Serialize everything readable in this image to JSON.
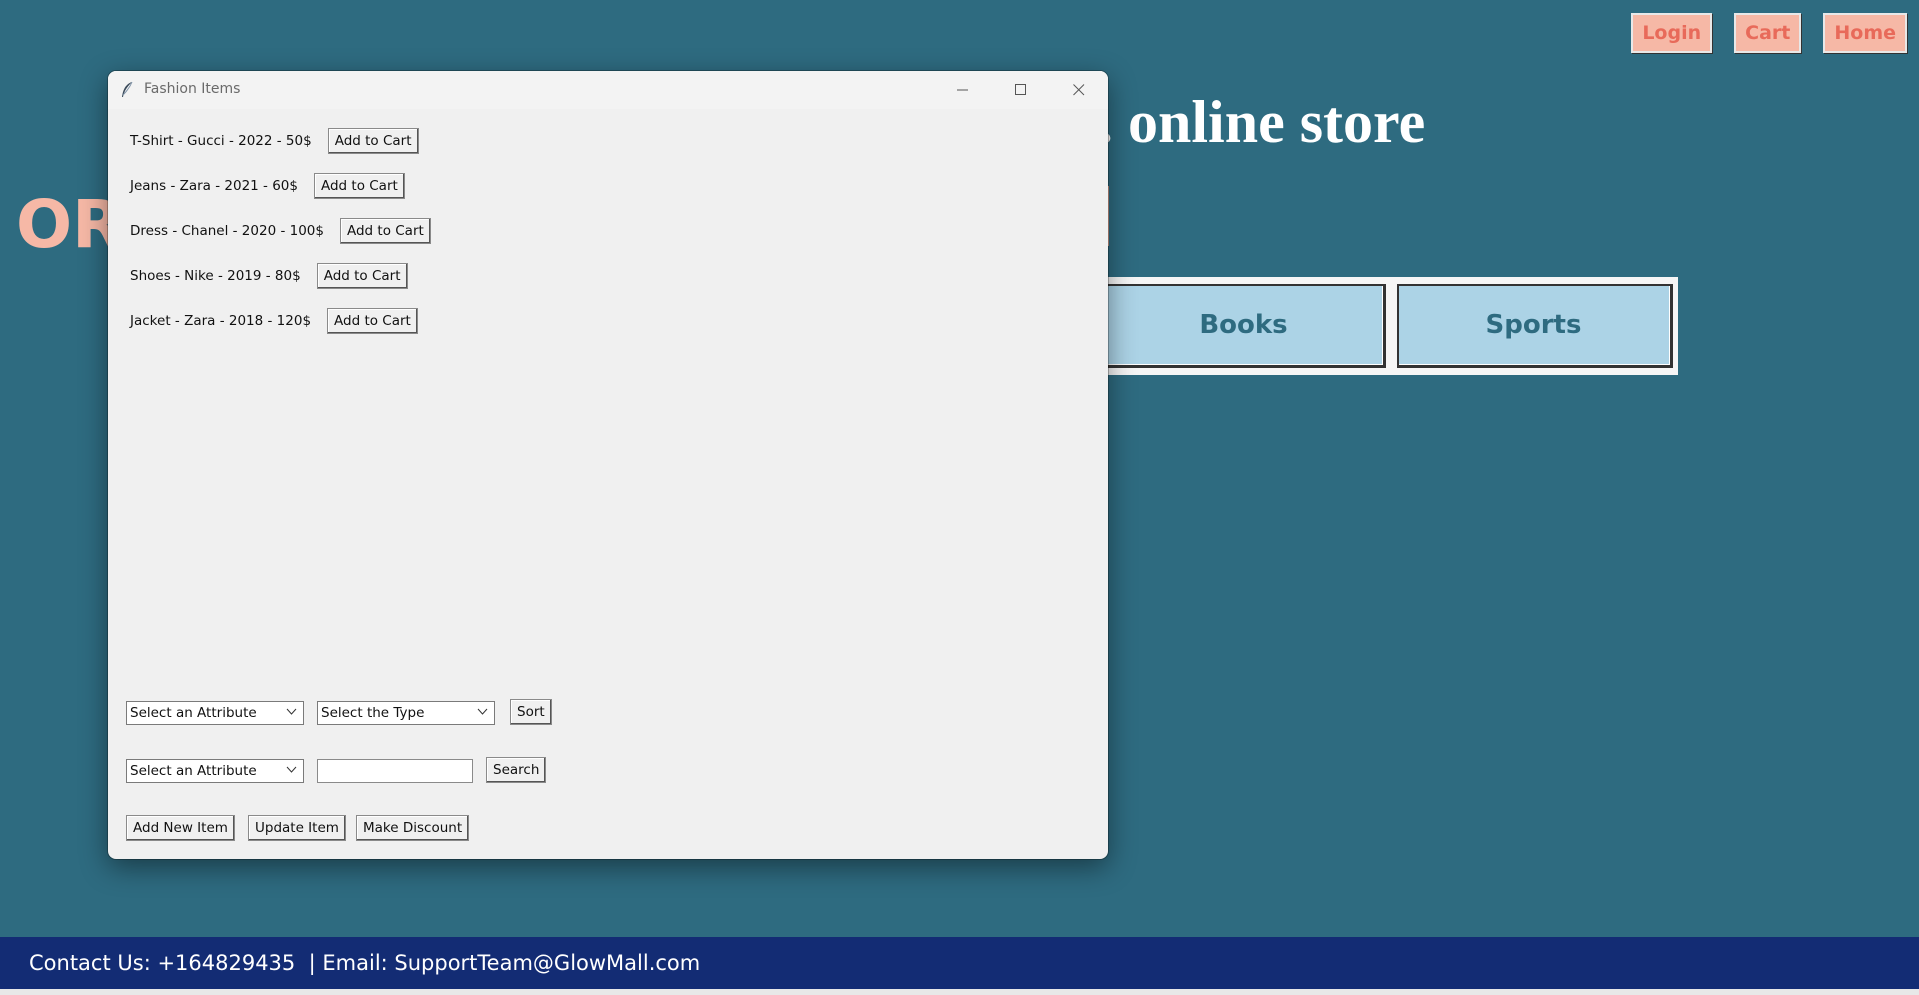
{
  "nav": {
    "login": "Login",
    "cart": "Cart",
    "home": "Home"
  },
  "hero": {
    "title_visible": "online store",
    "title_fragment": ".",
    "left_fragment": "OR"
  },
  "categories": [
    {
      "label": "Books"
    },
    {
      "label": "Sports"
    }
  ],
  "footer": {
    "text": "Contact Us: +164829435  | Email: SupportTeam@GlowMall.com"
  },
  "window": {
    "title": "Fashion Items",
    "items": [
      {
        "text": "T-Shirt - Gucci - 2022 - 50$",
        "button": "Add to Cart"
      },
      {
        "text": "Jeans - Zara - 2021 - 60$",
        "button": "Add to Cart"
      },
      {
        "text": "Dress - Chanel - 2020 - 100$",
        "button": "Add to Cart"
      },
      {
        "text": "Shoes - Nike - 2019 - 80$",
        "button": "Add to Cart"
      },
      {
        "text": "Jacket - Zara - 2018 - 120$",
        "button": "Add to Cart"
      }
    ],
    "sort": {
      "attribute_selected": "Select an Attribute",
      "type_selected": "Select the Type",
      "button": "Sort"
    },
    "search": {
      "attribute_selected": "Select an Attribute",
      "value": "",
      "button": "Search"
    },
    "actions": {
      "add": "Add New Item",
      "update": "Update Item",
      "discount": "Make Discount"
    }
  },
  "colors": {
    "background": "#2e6b80",
    "nav_button_bg": "#f6b8a6",
    "nav_button_text": "#e86a5a",
    "category_bg": "#acd3e6",
    "footer_bg": "#132c74"
  },
  "icons": {
    "window": "feather-icon",
    "minimize": "minimize-icon",
    "maximize": "maximize-icon",
    "close": "close-icon",
    "dropdown": "chevron-down-icon"
  }
}
